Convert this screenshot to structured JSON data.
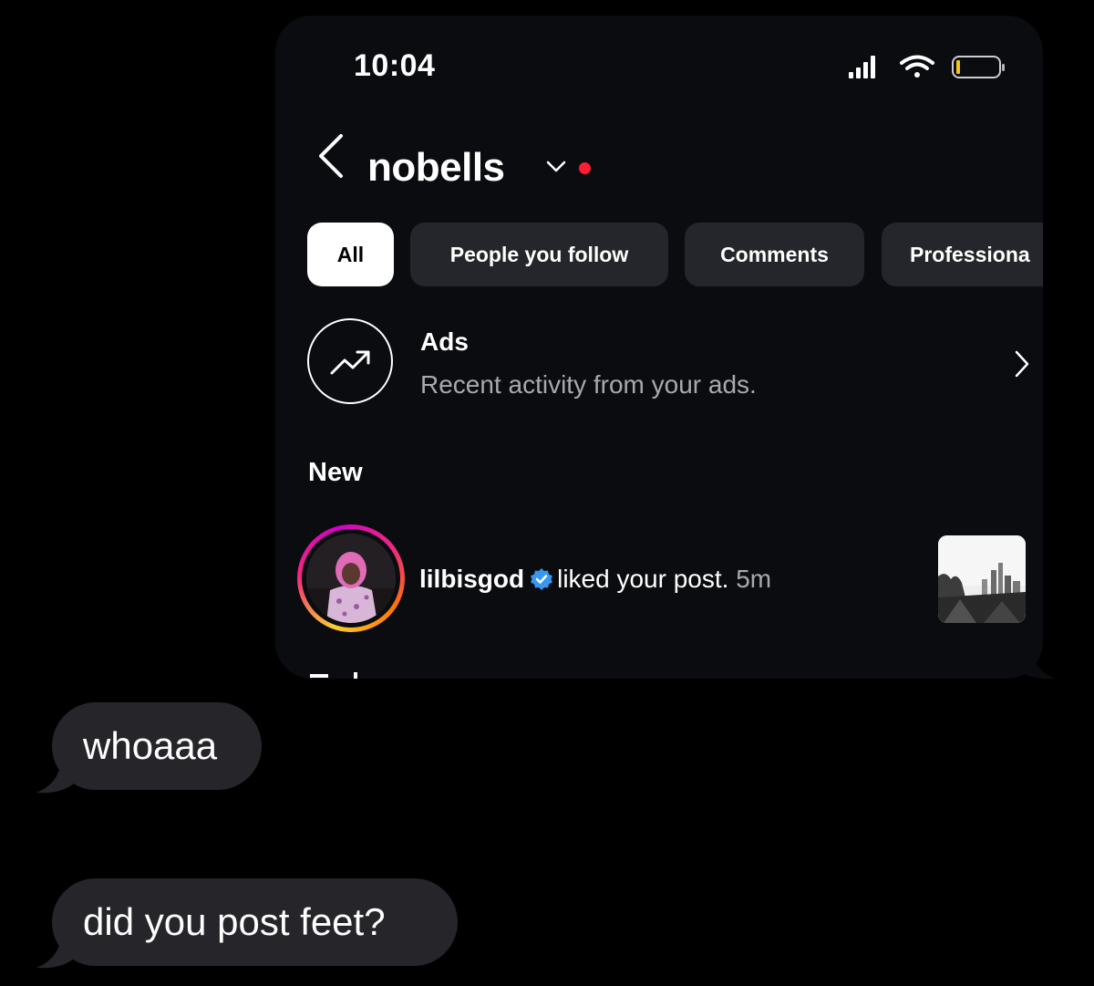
{
  "status_bar": {
    "time": "10:04"
  },
  "header": {
    "account_name": "nobells"
  },
  "tabs": [
    {
      "label": "All",
      "active": true
    },
    {
      "label": "People you follow",
      "active": false
    },
    {
      "label": "Comments",
      "active": false
    },
    {
      "label": "Professiona",
      "active": false
    }
  ],
  "ads": {
    "title": "Ads",
    "subtitle": "Recent activity from your ads."
  },
  "section": {
    "new_label": "New"
  },
  "notification": {
    "username": "lilbisgod",
    "action": "liked your post.",
    "time": "5m"
  },
  "messages": [
    {
      "text": "whoaaa"
    },
    {
      "text": "did you post feet?"
    }
  ],
  "colors": {
    "background": "#000000",
    "screenshot_bg": "#0b0c0f",
    "tab_bg": "#24262b",
    "received_bubble": "#26262a",
    "verified_blue": "#3897f0",
    "notification_dot": "#ff1e2f",
    "secondary_text": "#a8a9ae"
  }
}
